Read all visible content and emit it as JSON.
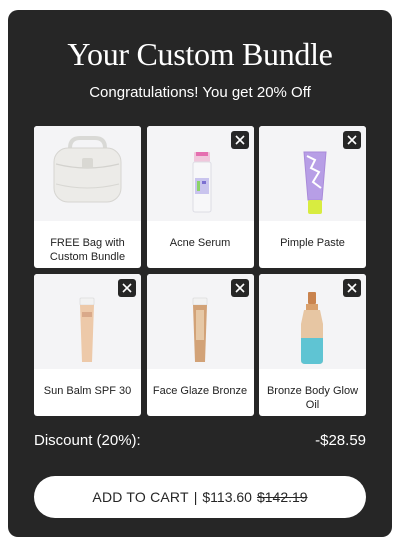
{
  "bundle": {
    "title": "Your Custom Bundle",
    "subtitle": "Congratulations! You get 20% Off"
  },
  "items": [
    {
      "label": "FREE Bag with Custom Bundle",
      "removable": false,
      "icon": "bag-image"
    },
    {
      "label": "Acne Serum",
      "removable": true,
      "icon": "serum-bottle-image"
    },
    {
      "label": "Pimple Paste",
      "removable": true,
      "icon": "paste-tube-image"
    },
    {
      "label": "Sun Balm SPF 30",
      "removable": true,
      "icon": "sun-balm-tube-image"
    },
    {
      "label": "Face Glaze Bronze",
      "removable": true,
      "icon": "face-glaze-tube-image"
    },
    {
      "label": "Bronze Body Glow Oil",
      "removable": true,
      "icon": "oil-bottle-image"
    }
  ],
  "summary": {
    "discount_label": "Discount (20%):",
    "discount_value": "-$28.59"
  },
  "cart": {
    "label": "ADD TO CART",
    "separator": "|",
    "price": "$113.60",
    "old_price": "$142.19"
  },
  "colors": {
    "panel": "#262626",
    "card_bg": "#ffffff",
    "image_bg": "#f4f4f6"
  }
}
